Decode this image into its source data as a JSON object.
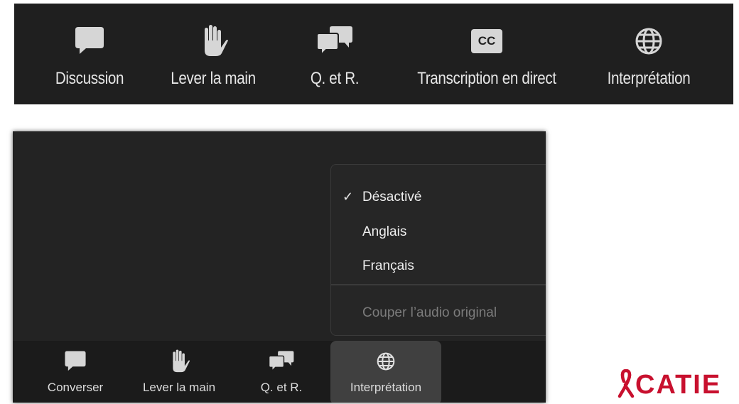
{
  "top_toolbar": {
    "items": [
      {
        "label": "Discussion",
        "icon": "chat-icon"
      },
      {
        "label": "Lever la main",
        "icon": "raise-hand-icon"
      },
      {
        "label": "Q. et R.",
        "icon": "qa-icon"
      },
      {
        "label": "Transcription en direct",
        "icon": "cc-icon",
        "icon_text": "CC"
      },
      {
        "label": "Interprétation",
        "icon": "globe-icon"
      }
    ]
  },
  "bottom_toolbar": {
    "items": [
      {
        "label": "Converser",
        "icon": "chat-icon"
      },
      {
        "label": "Lever la main",
        "icon": "raise-hand-icon"
      },
      {
        "label": "Q. et R.",
        "icon": "qa-icon"
      },
      {
        "label": "Interprétation",
        "icon": "globe-icon",
        "active": true
      }
    ]
  },
  "interpretation_menu": {
    "items": [
      {
        "label": "Désactivé",
        "checked": true,
        "check_mark": "✓"
      },
      {
        "label": "Anglais",
        "checked": false
      },
      {
        "label": "Français",
        "checked": false
      }
    ],
    "mute_original": {
      "label": "Couper l’audio original",
      "enabled": false
    }
  },
  "logo": {
    "text": "CATIE",
    "color": "#c8102e"
  },
  "colors": {
    "toolbar_bg": "#1f1f1f",
    "window_bg": "#232323",
    "icon": "#d9d9d9",
    "label": "#e6e6e6"
  }
}
